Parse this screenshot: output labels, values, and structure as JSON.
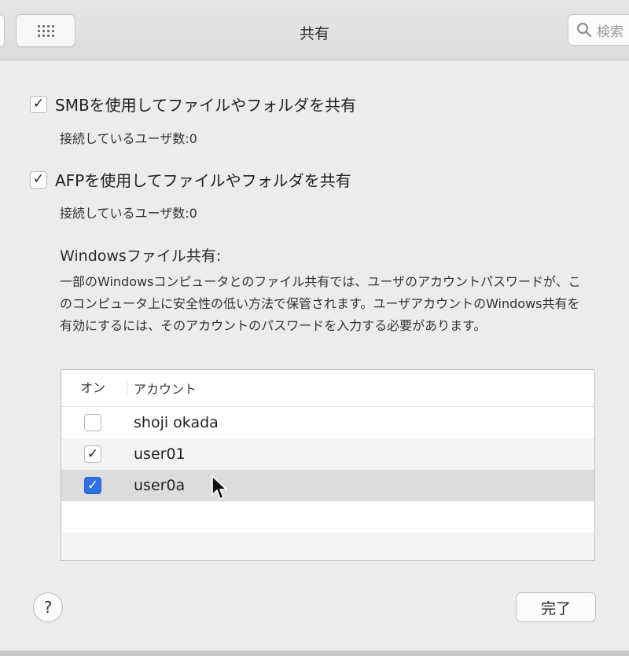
{
  "window": {
    "title": "共有"
  },
  "toolbar": {
    "search_placeholder": "検索"
  },
  "smb": {
    "label": "SMBを使用してファイルやフォルダを共有",
    "checked": true,
    "status": "接続しているユーザ数:0"
  },
  "afp": {
    "label": "AFPを使用してファイルやフォルダを共有",
    "checked": true,
    "status": "接続しているユーザ数:0"
  },
  "windows_sharing": {
    "title": "Windowsファイル共有:",
    "description": "一部のWindowsコンピュータとのファイル共有では、ユーザのアカウントパスワードが、このコンピュータ上に安全性の低い方法で保管されます。ユーザアカウントのWindows共有を有効にするには、そのアカウントのパスワードを入力する必要があります。"
  },
  "table": {
    "columns": {
      "on": "オン",
      "account": "アカウント"
    },
    "rows": [
      {
        "name": "shoji okada",
        "checked": false
      },
      {
        "name": "user01",
        "checked": true
      },
      {
        "name": "user0a",
        "checked": true
      }
    ]
  },
  "buttons": {
    "help": "?",
    "done": "完了"
  },
  "colors": {
    "accent": "#2f6fe4",
    "selected_row": "#dcdcdc"
  }
}
